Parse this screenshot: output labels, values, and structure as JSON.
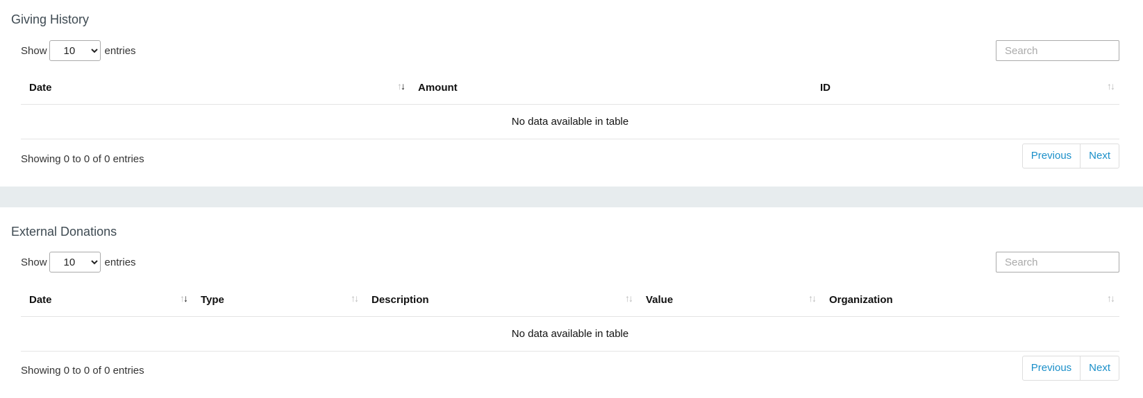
{
  "giving_history": {
    "title": "Giving History",
    "show_label": "Show",
    "entries_label": "entries",
    "page_length": "10",
    "search_placeholder": "Search",
    "columns": [
      "Date",
      "Amount",
      "ID"
    ],
    "empty_message": "No data available in table",
    "info": "Showing 0 to 0 of 0 entries",
    "prev_label": "Previous",
    "next_label": "Next"
  },
  "external_donations": {
    "title": "External Donations",
    "show_label": "Show",
    "entries_label": "entries",
    "page_length": "10",
    "search_placeholder": "Search",
    "columns": [
      "Date",
      "Type",
      "Description",
      "Value",
      "Organization"
    ],
    "empty_message": "No data available in table",
    "info": "Showing 0 to 0 of 0 entries",
    "prev_label": "Previous",
    "next_label": "Next"
  },
  "colors": {
    "link": "#1a8fc9",
    "section_gap": "#e7ecee",
    "title": "#3e4a52"
  }
}
